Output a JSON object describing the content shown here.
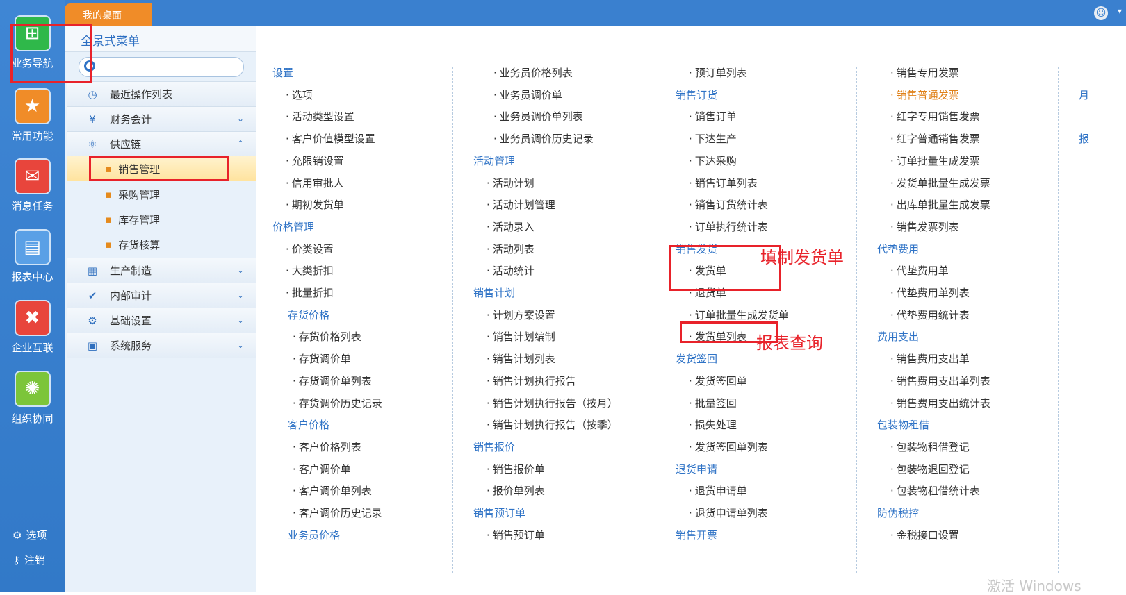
{
  "top": {
    "tab": "我的桌面"
  },
  "leftbar": {
    "items": [
      {
        "label": "业务导航",
        "icon": "business-nav-icon",
        "color": "#2fb84a"
      },
      {
        "label": "常用功能",
        "icon": "star-icon",
        "color": "#f08c28"
      },
      {
        "label": "消息任务",
        "icon": "mail-icon",
        "color": "#e8453c"
      },
      {
        "label": "报表中心",
        "icon": "report-icon",
        "color": "#5aa0e6"
      },
      {
        "label": "企业互联",
        "icon": "connect-icon",
        "color": "#e8453c"
      },
      {
        "label": "组织协同",
        "icon": "org-icon",
        "color": "#7cc53a"
      }
    ],
    "options": "选项",
    "logout": "注销"
  },
  "nav": {
    "title": "全景式菜单",
    "search_placeholder": "",
    "items": [
      {
        "label": "最近操作列表",
        "icon": "clock-icon"
      },
      {
        "label": "财务会计",
        "icon": "yen-icon"
      },
      {
        "label": "供应链",
        "icon": "supply-chain-icon"
      },
      {
        "label": "生产制造",
        "icon": "factory-icon"
      },
      {
        "label": "内部审计",
        "icon": "clipboard-icon"
      },
      {
        "label": "基础设置",
        "icon": "gear-icon"
      },
      {
        "label": "系统服务",
        "icon": "service-icon"
      }
    ],
    "sub": [
      "销售管理",
      "采购管理",
      "库存管理",
      "存货核算"
    ]
  },
  "menu": {
    "col1": [
      {
        "t": "设置",
        "k": "h"
      },
      {
        "t": "选项",
        "k": "l"
      },
      {
        "t": "活动类型设置",
        "k": "l"
      },
      {
        "t": "客户价值模型设置",
        "k": "l"
      },
      {
        "t": "允限销设置",
        "k": "l"
      },
      {
        "t": "信用审批人",
        "k": "l"
      },
      {
        "t": "期初发货单",
        "k": "l"
      },
      {
        "t": "价格管理",
        "k": "h"
      },
      {
        "t": "价类设置",
        "k": "l"
      },
      {
        "t": "大类折扣",
        "k": "l"
      },
      {
        "t": "批量折扣",
        "k": "l"
      },
      {
        "t": "存货价格",
        "k": "h2"
      },
      {
        "t": "存货价格列表",
        "k": "l2"
      },
      {
        "t": "存货调价单",
        "k": "l2"
      },
      {
        "t": "存货调价单列表",
        "k": "l2"
      },
      {
        "t": "存货调价历史记录",
        "k": "l2"
      },
      {
        "t": "客户价格",
        "k": "h2"
      },
      {
        "t": "客户价格列表",
        "k": "l2"
      },
      {
        "t": "客户调价单",
        "k": "l2"
      },
      {
        "t": "客户调价单列表",
        "k": "l2"
      },
      {
        "t": "客户调价历史记录",
        "k": "l2"
      },
      {
        "t": "业务员价格",
        "k": "h2"
      }
    ],
    "col2": [
      {
        "t": "业务员价格列表",
        "k": "l2"
      },
      {
        "t": "业务员调价单",
        "k": "l2"
      },
      {
        "t": "业务员调价单列表",
        "k": "l2"
      },
      {
        "t": "业务员调价历史记录",
        "k": "l2"
      },
      {
        "t": "活动管理",
        "k": "h"
      },
      {
        "t": "活动计划",
        "k": "l"
      },
      {
        "t": "活动计划管理",
        "k": "l"
      },
      {
        "t": "活动录入",
        "k": "l"
      },
      {
        "t": "活动列表",
        "k": "l"
      },
      {
        "t": "活动统计",
        "k": "l"
      },
      {
        "t": "销售计划",
        "k": "h"
      },
      {
        "t": "计划方案设置",
        "k": "l"
      },
      {
        "t": "销售计划编制",
        "k": "l"
      },
      {
        "t": "销售计划列表",
        "k": "l"
      },
      {
        "t": "销售计划执行报告",
        "k": "l"
      },
      {
        "t": "销售计划执行报告（按月）",
        "k": "l"
      },
      {
        "t": "销售计划执行报告（按季）",
        "k": "l"
      },
      {
        "t": "销售报价",
        "k": "h"
      },
      {
        "t": "销售报价单",
        "k": "l"
      },
      {
        "t": "报价单列表",
        "k": "l"
      },
      {
        "t": "销售预订单",
        "k": "h"
      },
      {
        "t": "销售预订单",
        "k": "l"
      }
    ],
    "col3": [
      {
        "t": "预订单列表",
        "k": "l"
      },
      {
        "t": "销售订货",
        "k": "h"
      },
      {
        "t": "销售订单",
        "k": "l"
      },
      {
        "t": "下达生产",
        "k": "l"
      },
      {
        "t": "下达采购",
        "k": "l"
      },
      {
        "t": "销售订单列表",
        "k": "l"
      },
      {
        "t": "销售订货统计表",
        "k": "l"
      },
      {
        "t": "订单执行统计表",
        "k": "l"
      },
      {
        "t": "销售发货",
        "k": "h"
      },
      {
        "t": "发货单",
        "k": "l"
      },
      {
        "t": "退货单",
        "k": "l"
      },
      {
        "t": "订单批量生成发货单",
        "k": "l"
      },
      {
        "t": "发货单列表",
        "k": "l"
      },
      {
        "t": "发货签回",
        "k": "h"
      },
      {
        "t": "发货签回单",
        "k": "l"
      },
      {
        "t": "批量签回",
        "k": "l"
      },
      {
        "t": "损失处理",
        "k": "l"
      },
      {
        "t": "发货签回单列表",
        "k": "l"
      },
      {
        "t": "退货申请",
        "k": "h"
      },
      {
        "t": "退货申请单",
        "k": "l"
      },
      {
        "t": "退货申请单列表",
        "k": "l"
      },
      {
        "t": "销售开票",
        "k": "h"
      }
    ],
    "col4": [
      {
        "t": "销售专用发票",
        "k": "l"
      },
      {
        "t": "销售普通发票",
        "k": "act"
      },
      {
        "t": "红字专用销售发票",
        "k": "l"
      },
      {
        "t": "红字普通销售发票",
        "k": "l"
      },
      {
        "t": "订单批量生成发票",
        "k": "l"
      },
      {
        "t": "发货单批量生成发票",
        "k": "l"
      },
      {
        "t": "出库单批量生成发票",
        "k": "l"
      },
      {
        "t": "销售发票列表",
        "k": "l"
      },
      {
        "t": "代垫费用",
        "k": "h"
      },
      {
        "t": "代垫费用单",
        "k": "l"
      },
      {
        "t": "代垫费用单列表",
        "k": "l"
      },
      {
        "t": "代垫费用统计表",
        "k": "l"
      },
      {
        "t": "费用支出",
        "k": "h"
      },
      {
        "t": "销售费用支出单",
        "k": "l"
      },
      {
        "t": "销售费用支出单列表",
        "k": "l"
      },
      {
        "t": "销售费用支出统计表",
        "k": "l"
      },
      {
        "t": "包装物租借",
        "k": "h"
      },
      {
        "t": "包装物租借登记",
        "k": "l"
      },
      {
        "t": "包装物退回登记",
        "k": "l"
      },
      {
        "t": "包装物租借统计表",
        "k": "l"
      },
      {
        "t": "防伪税控",
        "k": "h"
      },
      {
        "t": "金税接口设置",
        "k": "l"
      }
    ],
    "col5": [
      {
        "t": "月",
        "k": "h"
      },
      {
        "t": "报",
        "k": "h"
      }
    ]
  },
  "annotations": {
    "fill": "填制发货单",
    "query": "报表查询"
  },
  "watermark": "激活 Windows"
}
